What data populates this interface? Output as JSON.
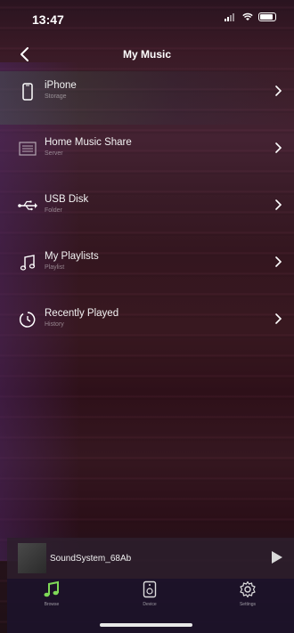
{
  "status_bar": {
    "time": "13:47"
  },
  "nav": {
    "title": "My Music"
  },
  "items": [
    {
      "label": "iPhone",
      "sub": "Storage",
      "icon": "phone-icon"
    },
    {
      "label": "Home Music Share",
      "sub": "Server",
      "icon": "server-icon"
    },
    {
      "label": "USB Disk",
      "sub": "Folder",
      "icon": "usb-icon"
    },
    {
      "label": "My Playlists",
      "sub": "Playlist",
      "icon": "music-note-icon"
    },
    {
      "label": "Recently Played",
      "sub": "History",
      "icon": "history-icon"
    }
  ],
  "player": {
    "device_name": "SoundSystem_68Ab",
    "icon": "play-icon"
  },
  "tabs": [
    {
      "label": "Browse",
      "icon": "music-note-icon",
      "active": true
    },
    {
      "label": "Device",
      "icon": "speaker-icon",
      "active": false
    },
    {
      "label": "Settings",
      "icon": "gear-icon",
      "active": false
    }
  ],
  "colors": {
    "accent": "#7ed957",
    "background": "#3a1a26",
    "tab_bar": "#1c122a"
  }
}
